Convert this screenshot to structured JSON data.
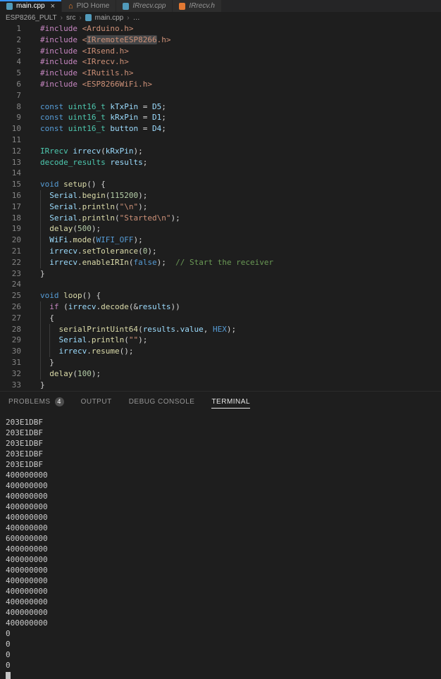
{
  "colors": {
    "accent_blue": "#3794FF",
    "tabbar_bg": "#252526",
    "tab_inactive_bg": "#2D2D2D",
    "editor_bg": "#1E1E1E",
    "badge_bg": "#4D4D4D",
    "cpp_icon_color": "#519ABA",
    "pio_icon_color": "#F5822A",
    "header_icon_color": "#E37933",
    "terminal_text": "#CCCCCC"
  },
  "icons": {
    "close": "×",
    "home": "⌂",
    "chevron": "›"
  },
  "tabs": [
    {
      "label": "main.cpp",
      "icon": "cpp-file-icon",
      "active": true,
      "close": "×"
    },
    {
      "label": "PIO Home",
      "icon": "pio-home-icon"
    },
    {
      "label": "IRrecv.cpp",
      "icon": "cpp-file-icon",
      "italic": true
    },
    {
      "label": "IRrecv.h",
      "icon": "header-file-icon",
      "italic": true
    }
  ],
  "breadcrumb": {
    "items": [
      "ESP8266_PULT",
      "src",
      "main.cpp",
      "…"
    ]
  },
  "editor": {
    "lines": [
      {
        "n": 1,
        "ind": 0,
        "seg": [
          [
            "dir",
            "#include"
          ],
          [
            "pun",
            " "
          ],
          [
            "str",
            "<Arduino.h>"
          ]
        ]
      },
      {
        "n": 2,
        "ind": 0,
        "seg": [
          [
            "dir",
            "#include"
          ],
          [
            "pun",
            " "
          ],
          [
            "str",
            "<"
          ],
          [
            "strhl",
            "IRremoteESP8266"
          ],
          [
            "str",
            ".h>"
          ]
        ]
      },
      {
        "n": 3,
        "ind": 0,
        "seg": [
          [
            "dir",
            "#include"
          ],
          [
            "pun",
            " "
          ],
          [
            "str",
            "<IRsend.h>"
          ]
        ]
      },
      {
        "n": 4,
        "ind": 0,
        "seg": [
          [
            "dir",
            "#include"
          ],
          [
            "pun",
            " "
          ],
          [
            "str",
            "<IRrecv.h>"
          ]
        ]
      },
      {
        "n": 5,
        "ind": 0,
        "seg": [
          [
            "dir",
            "#include"
          ],
          [
            "pun",
            " "
          ],
          [
            "str",
            "<IRutils.h>"
          ]
        ]
      },
      {
        "n": 6,
        "ind": 0,
        "seg": [
          [
            "dir",
            "#include"
          ],
          [
            "pun",
            " "
          ],
          [
            "str",
            "<ESP8266WiFi.h>"
          ]
        ]
      },
      {
        "n": 7,
        "ind": 0,
        "seg": []
      },
      {
        "n": 8,
        "ind": 0,
        "seg": [
          [
            "kw",
            "const"
          ],
          [
            "pun",
            " "
          ],
          [
            "type",
            "uint16_t"
          ],
          [
            "pun",
            " "
          ],
          [
            "var",
            "kTxPin"
          ],
          [
            "pun",
            " = "
          ],
          [
            "var",
            "D5"
          ],
          [
            "pun",
            ";"
          ]
        ]
      },
      {
        "n": 9,
        "ind": 0,
        "seg": [
          [
            "kw",
            "const"
          ],
          [
            "pun",
            " "
          ],
          [
            "type",
            "uint16_t"
          ],
          [
            "pun",
            " "
          ],
          [
            "var",
            "kRxPin"
          ],
          [
            "pun",
            " = "
          ],
          [
            "var",
            "D1"
          ],
          [
            "pun",
            ";"
          ]
        ]
      },
      {
        "n": 10,
        "ind": 0,
        "seg": [
          [
            "kw",
            "const"
          ],
          [
            "pun",
            " "
          ],
          [
            "type",
            "uint16_t"
          ],
          [
            "pun",
            " "
          ],
          [
            "var",
            "button"
          ],
          [
            "pun",
            " = "
          ],
          [
            "var",
            "D4"
          ],
          [
            "pun",
            ";"
          ]
        ]
      },
      {
        "n": 11,
        "ind": 0,
        "seg": []
      },
      {
        "n": 12,
        "ind": 0,
        "seg": [
          [
            "type",
            "IRrecv"
          ],
          [
            "pun",
            " "
          ],
          [
            "var",
            "irrecv"
          ],
          [
            "pun",
            "("
          ],
          [
            "var",
            "kRxPin"
          ],
          [
            "pun",
            ");"
          ]
        ]
      },
      {
        "n": 13,
        "ind": 0,
        "seg": [
          [
            "type",
            "decode_results"
          ],
          [
            "pun",
            " "
          ],
          [
            "var",
            "results"
          ],
          [
            "pun",
            ";"
          ]
        ]
      },
      {
        "n": 14,
        "ind": 0,
        "seg": []
      },
      {
        "n": 15,
        "ind": 0,
        "seg": [
          [
            "kw",
            "void"
          ],
          [
            "pun",
            " "
          ],
          [
            "fn",
            "setup"
          ],
          [
            "pun",
            "() {"
          ]
        ]
      },
      {
        "n": 16,
        "ind": 1,
        "seg": [
          [
            "var",
            "Serial"
          ],
          [
            "pun",
            "."
          ],
          [
            "fn",
            "begin"
          ],
          [
            "pun",
            "("
          ],
          [
            "num",
            "115200"
          ],
          [
            "pun",
            ");"
          ]
        ]
      },
      {
        "n": 17,
        "ind": 1,
        "seg": [
          [
            "var",
            "Serial"
          ],
          [
            "pun",
            "."
          ],
          [
            "fn",
            "println"
          ],
          [
            "pun",
            "("
          ],
          [
            "str",
            "\"\\n\""
          ],
          [
            "pun",
            ");"
          ]
        ]
      },
      {
        "n": 18,
        "ind": 1,
        "seg": [
          [
            "var",
            "Serial"
          ],
          [
            "pun",
            "."
          ],
          [
            "fn",
            "println"
          ],
          [
            "pun",
            "("
          ],
          [
            "str",
            "\"Started\\n\""
          ],
          [
            "pun",
            ");"
          ]
        ]
      },
      {
        "n": 19,
        "ind": 1,
        "seg": [
          [
            "fn",
            "delay"
          ],
          [
            "pun",
            "("
          ],
          [
            "num",
            "500"
          ],
          [
            "pun",
            ");"
          ]
        ]
      },
      {
        "n": 20,
        "ind": 1,
        "seg": [
          [
            "var",
            "WiFi"
          ],
          [
            "pun",
            "."
          ],
          [
            "fn",
            "mode"
          ],
          [
            "pun",
            "("
          ],
          [
            "cst",
            "WIFI_OFF"
          ],
          [
            "pun",
            ");"
          ]
        ]
      },
      {
        "n": 21,
        "ind": 1,
        "seg": [
          [
            "var",
            "irrecv"
          ],
          [
            "pun",
            "."
          ],
          [
            "fn",
            "setTolerance"
          ],
          [
            "pun",
            "("
          ],
          [
            "num",
            "0"
          ],
          [
            "pun",
            ");"
          ]
        ]
      },
      {
        "n": 22,
        "ind": 1,
        "seg": [
          [
            "var",
            "irrecv"
          ],
          [
            "pun",
            "."
          ],
          [
            "fn",
            "enableIRIn"
          ],
          [
            "pun",
            "("
          ],
          [
            "kw",
            "false"
          ],
          [
            "pun",
            ");  "
          ],
          [
            "cmt",
            "// Start the receiver"
          ]
        ]
      },
      {
        "n": 23,
        "ind": 0,
        "seg": [
          [
            "pun",
            "}"
          ]
        ]
      },
      {
        "n": 24,
        "ind": 0,
        "seg": []
      },
      {
        "n": 25,
        "ind": 0,
        "seg": [
          [
            "kw",
            "void"
          ],
          [
            "pun",
            " "
          ],
          [
            "fn",
            "loop"
          ],
          [
            "pun",
            "() {"
          ]
        ]
      },
      {
        "n": 26,
        "ind": 1,
        "seg": [
          [
            "ctrl",
            "if"
          ],
          [
            "pun",
            " ("
          ],
          [
            "var",
            "irrecv"
          ],
          [
            "pun",
            "."
          ],
          [
            "fn",
            "decode"
          ],
          [
            "pun",
            "(&"
          ],
          [
            "var",
            "results"
          ],
          [
            "pun",
            "))"
          ]
        ]
      },
      {
        "n": 27,
        "ind": 1,
        "seg": [
          [
            "pun",
            "{"
          ]
        ]
      },
      {
        "n": 28,
        "ind": 2,
        "seg": [
          [
            "fn",
            "serialPrintUint64"
          ],
          [
            "pun",
            "("
          ],
          [
            "var",
            "results"
          ],
          [
            "pun",
            "."
          ],
          [
            "var",
            "value"
          ],
          [
            "pun",
            ", "
          ],
          [
            "cst",
            "HEX"
          ],
          [
            "pun",
            ");"
          ]
        ]
      },
      {
        "n": 29,
        "ind": 2,
        "seg": [
          [
            "var",
            "Serial"
          ],
          [
            "pun",
            "."
          ],
          [
            "fn",
            "println"
          ],
          [
            "pun",
            "("
          ],
          [
            "str",
            "\"\""
          ],
          [
            "pun",
            ");"
          ]
        ]
      },
      {
        "n": 30,
        "ind": 2,
        "seg": [
          [
            "var",
            "irrecv"
          ],
          [
            "pun",
            "."
          ],
          [
            "fn",
            "resume"
          ],
          [
            "pun",
            "();"
          ]
        ]
      },
      {
        "n": 31,
        "ind": 1,
        "seg": [
          [
            "pun",
            "}"
          ]
        ]
      },
      {
        "n": 32,
        "ind": 1,
        "seg": [
          [
            "fn",
            "delay"
          ],
          [
            "pun",
            "("
          ],
          [
            "num",
            "100"
          ],
          [
            "pun",
            ");"
          ]
        ]
      },
      {
        "n": 33,
        "ind": 0,
        "seg": [
          [
            "pun",
            "}"
          ]
        ]
      }
    ]
  },
  "panel": {
    "tabs": [
      {
        "label": "PROBLEMS",
        "badge": "4"
      },
      {
        "label": "OUTPUT"
      },
      {
        "label": "DEBUG CONSOLE"
      },
      {
        "label": "TERMINAL",
        "active": true
      }
    ]
  },
  "terminal": {
    "lines": [
      "203E1DBF",
      "203E1DBF",
      "203E1DBF",
      "203E1DBF",
      "203E1DBF",
      "400000000",
      "400000000",
      "400000000",
      "400000000",
      "400000000",
      "400000000",
      "600000000",
      "400000000",
      "400000000",
      "400000000",
      "400000000",
      "400000000",
      "400000000",
      "400000000",
      "400000000",
      "0",
      "0",
      "0",
      "0"
    ],
    "cursor_visible": true
  }
}
